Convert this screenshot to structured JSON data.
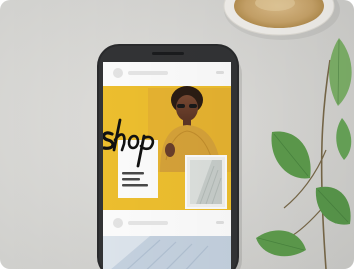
{
  "image": {
    "alt": "",
    "scene_labels": {
      "backdrop": "tabletop",
      "device": "smartphone",
      "props": [
        "coffee-cup",
        "eucalyptus-branch"
      ]
    },
    "screen_post": {
      "script_word": "shop",
      "caption_lines": [
        "",
        "",
        ""
      ],
      "header_text": "",
      "footer_text": ""
    },
    "colors": {
      "table": "#dcdcda",
      "phone_body": "#2a2b2d",
      "screen_bg": "#ffffff",
      "post_yellow": "#f0c12f",
      "leaf_green": "#6aa85a",
      "cup_rim": "#f4f2ee",
      "coffee": "#d4b27a"
    }
  }
}
